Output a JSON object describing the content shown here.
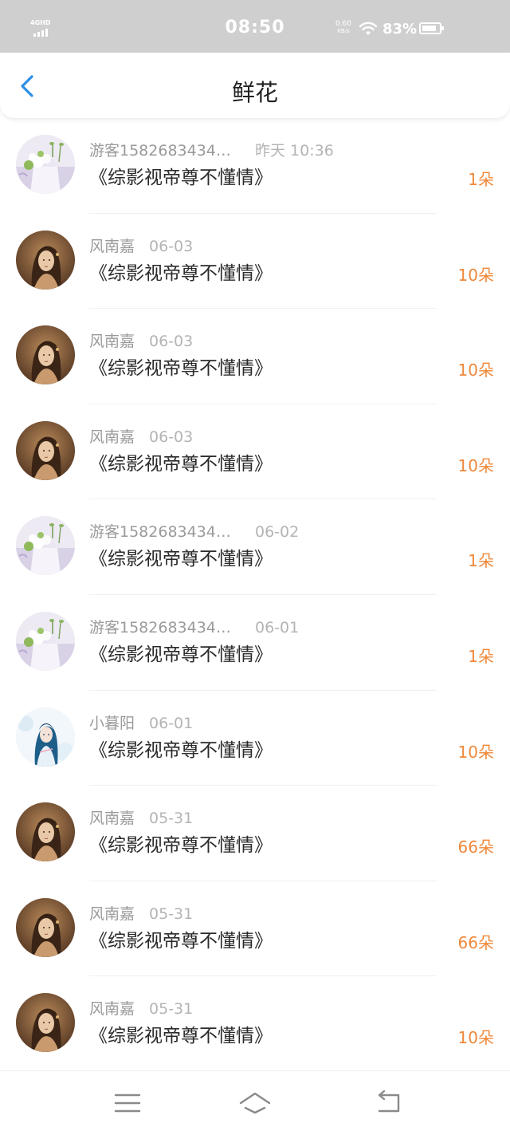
{
  "status_bar": {
    "network": "4GHD",
    "time": "08:50",
    "speed_value": "0.60",
    "speed_unit": "KB/s",
    "battery": "83%",
    "battery_level": 0.83
  },
  "header": {
    "title": "鲜花",
    "back_icon": "chevron-left-icon"
  },
  "colors": {
    "accent": "#2b8fe6",
    "count": "#f0883a",
    "meta": "#a8a8a8",
    "title": "#2a2a2a"
  },
  "list": [
    {
      "user": "游客1582683434…",
      "date": "昨天 10:36",
      "book": "《综影视帝尊不懂情》",
      "count": "1朵",
      "avatar": "guest-flower"
    },
    {
      "user": "风南嘉",
      "date": "06-03",
      "book": "《综影视帝尊不懂情》",
      "count": "10朵",
      "avatar": "portrait-warm"
    },
    {
      "user": "风南嘉",
      "date": "06-03",
      "book": "《综影视帝尊不懂情》",
      "count": "10朵",
      "avatar": "portrait-warm"
    },
    {
      "user": "风南嘉",
      "date": "06-03",
      "book": "《综影视帝尊不懂情》",
      "count": "10朵",
      "avatar": "portrait-warm"
    },
    {
      "user": "游客1582683434…",
      "date": "06-02",
      "book": "《综影视帝尊不懂情》",
      "count": "1朵",
      "avatar": "guest-flower"
    },
    {
      "user": "游客1582683434…",
      "date": "06-01",
      "book": "《综影视帝尊不懂情》",
      "count": "1朵",
      "avatar": "guest-flower"
    },
    {
      "user": "小暮阳",
      "date": "06-01",
      "book": "《综影视帝尊不懂情》",
      "count": "10朵",
      "avatar": "portrait-blue"
    },
    {
      "user": "风南嘉",
      "date": "05-31",
      "book": "《综影视帝尊不懂情》",
      "count": "66朵",
      "avatar": "portrait-warm"
    },
    {
      "user": "风南嘉",
      "date": "05-31",
      "book": "《综影视帝尊不懂情》",
      "count": "66朵",
      "avatar": "portrait-warm"
    },
    {
      "user": "风南嘉",
      "date": "05-31",
      "book": "《综影视帝尊不懂情》",
      "count": "10朵",
      "avatar": "portrait-warm"
    }
  ],
  "nav": {
    "menu_icon": "menu-icon",
    "home_icon": "home-icon",
    "back_icon": "back-arrow-icon"
  }
}
